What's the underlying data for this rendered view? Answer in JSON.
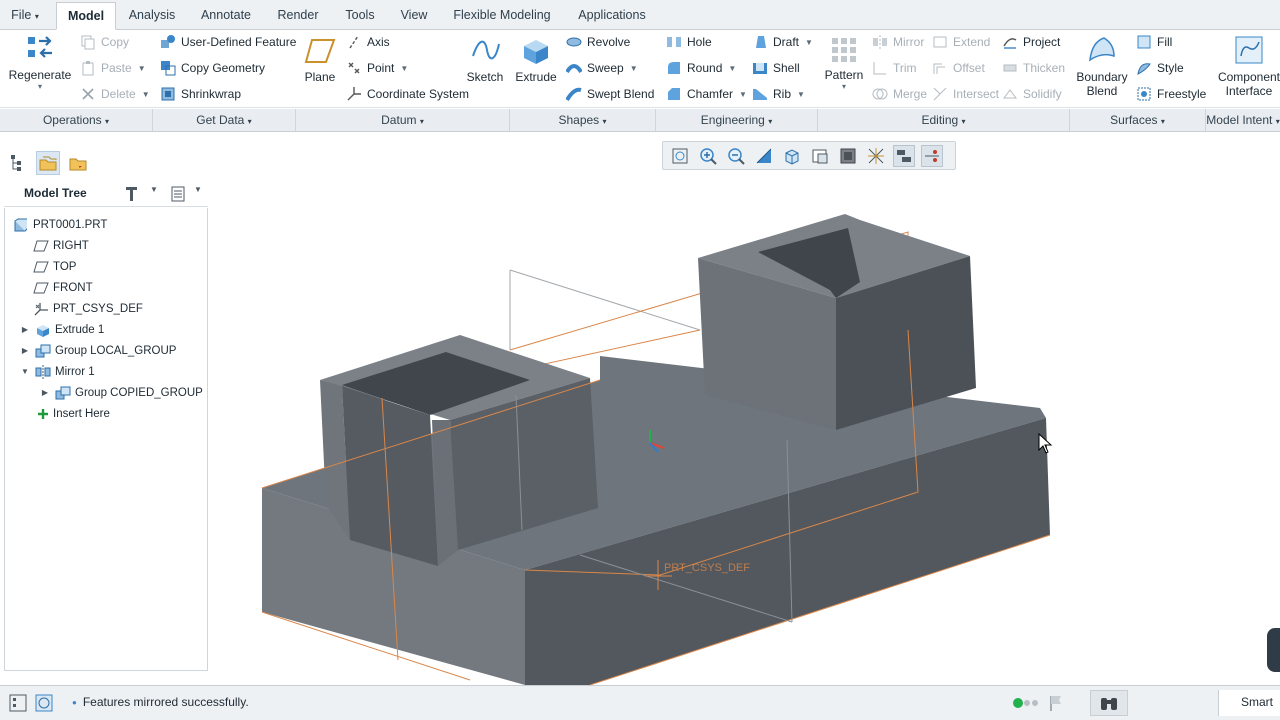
{
  "tabs": [
    "File",
    "Model",
    "Analysis",
    "Annotate",
    "Render",
    "Tools",
    "View",
    "Flexible Modeling",
    "Applications"
  ],
  "active_tab": "Model",
  "ribbon": {
    "regenerate": "Regenerate",
    "copy": "Copy",
    "paste": "Paste",
    "delete": "Delete",
    "user_defined_feature": "User-Defined Feature",
    "copy_geometry": "Copy Geometry",
    "shrinkwrap": "Shrinkwrap",
    "plane": "Plane",
    "axis": "Axis",
    "point": "Point",
    "coordinate_system": "Coordinate System",
    "sketch": "Sketch",
    "extrude": "Extrude",
    "revolve": "Revolve",
    "sweep": "Sweep",
    "swept_blend": "Swept Blend",
    "hole": "Hole",
    "round": "Round",
    "chamfer": "Chamfer",
    "draft": "Draft",
    "shell": "Shell",
    "rib": "Rib",
    "pattern": "Pattern",
    "mirror": "Mirror",
    "trim": "Trim",
    "merge": "Merge",
    "extend": "Extend",
    "offset": "Offset",
    "intersect": "Intersect",
    "project": "Project",
    "thicken": "Thicken",
    "solidify": "Solidify",
    "boundary_blend_1": "Boundary",
    "boundary_blend_2": "Blend",
    "fill": "Fill",
    "style": "Style",
    "freestyle": "Freestyle",
    "component_interface_1": "Component",
    "component_interface_2": "Interface"
  },
  "groups": [
    "Operations",
    "Get Data",
    "Datum",
    "Shapes",
    "Engineering",
    "Editing",
    "Surfaces",
    "Model Intent"
  ],
  "model_tree": {
    "title": "Model Tree",
    "items": [
      {
        "label": "PRT0001.PRT"
      },
      {
        "label": "RIGHT"
      },
      {
        "label": "TOP"
      },
      {
        "label": "FRONT"
      },
      {
        "label": "PRT_CSYS_DEF"
      },
      {
        "label": "Extrude 1"
      },
      {
        "label": "Group LOCAL_GROUP"
      },
      {
        "label": "Mirror 1"
      },
      {
        "label": "Group COPIED_GROUP"
      },
      {
        "label": "Insert Here"
      }
    ]
  },
  "viewport": {
    "csys_label": "PRT_CSYS_DEF"
  },
  "status": {
    "message": "Features mirrored successfully.",
    "filter": "Smart"
  },
  "colors": {
    "accent": "#1f6fb5",
    "model_face_light": "#717880",
    "model_face_mid": "#5f666e",
    "model_face_dark": "#4d535a",
    "datum_orange": "#d9874a"
  },
  "icons": {
    "regenerate": "regenerate-icon",
    "extrude": "extrude-icon",
    "sketch": "sketch-icon",
    "plane": "plane-icon",
    "pattern": "pattern-icon",
    "boundary_blend": "boundary-blend-icon",
    "component_interface": "component-interface-icon"
  }
}
